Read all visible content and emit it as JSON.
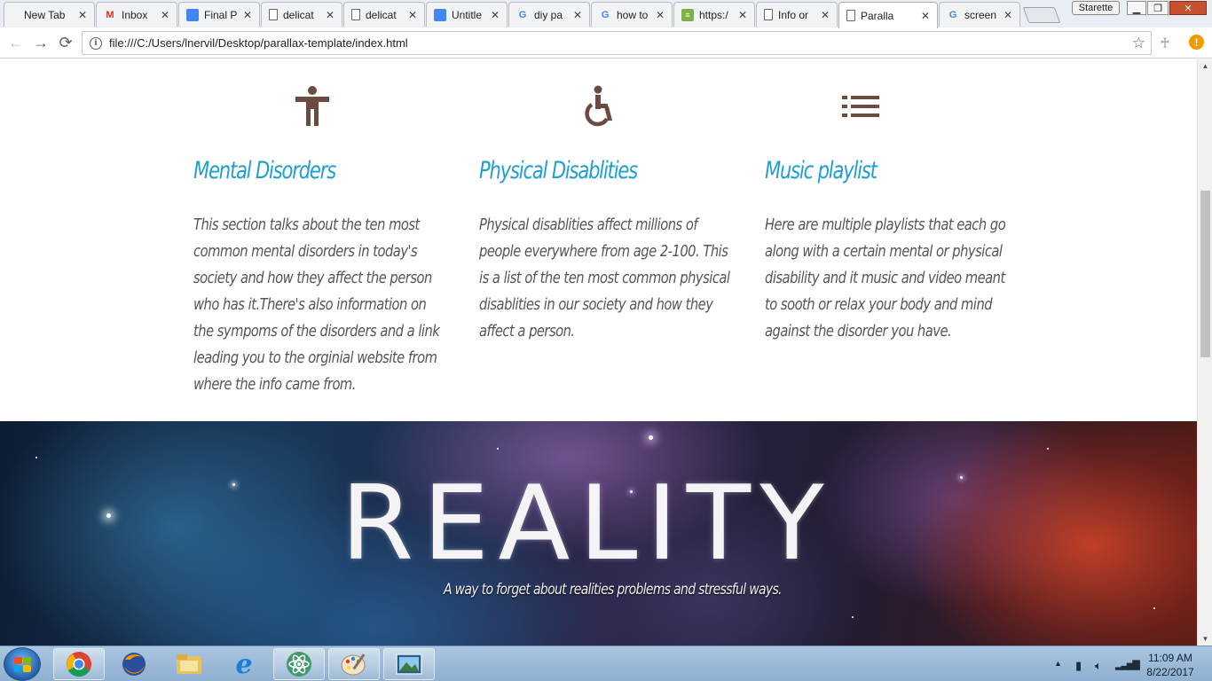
{
  "browser": {
    "tabs": [
      {
        "title": "New Tab",
        "favicon": "none"
      },
      {
        "title": "Inbox",
        "favicon": "gmail-icon"
      },
      {
        "title": "Final P",
        "favicon": "docs-icon"
      },
      {
        "title": "delicat",
        "favicon": "page-icon"
      },
      {
        "title": "delicat",
        "favicon": "page-icon"
      },
      {
        "title": "Untitle",
        "favicon": "docs-icon"
      },
      {
        "title": "diy pa",
        "favicon": "google-icon"
      },
      {
        "title": "how to",
        "favicon": "google-icon"
      },
      {
        "title": "https:/",
        "favicon": "sheets-icon"
      },
      {
        "title": "Info or",
        "favicon": "page-icon"
      },
      {
        "title": "Paralla",
        "favicon": "page-icon",
        "active": true
      },
      {
        "title": "screen",
        "favicon": "google-icon"
      }
    ],
    "profile_name": "Starette",
    "address": "file:///C:/Users/lnervil/Desktop/parallax-template/index.html"
  },
  "page": {
    "columns": [
      {
        "icon": "accessibility-icon",
        "heading": "Mental Disorders",
        "text": "This section talks about the ten most common mental disorders in today's society and how they affect the person who has it.There's also information on the sympoms of the disorders and a link leading you to the orginial website from where the info came from."
      },
      {
        "icon": "wheelchair-icon",
        "heading": "Physical Disablities",
        "text": "Physical disablities affect millions of people everywhere from age 2-100. This is a list of the ten most common physical disablities in our society and how they affect a person."
      },
      {
        "icon": "list-icon",
        "heading": "Music playlist",
        "text": "Here are multiple playlists that each go along with a certain mental or physical disability and it music and video meant to sooth or relax your body and mind against the disorder you have."
      }
    ],
    "hero": {
      "title": "REALITY",
      "tagline": "A way to forget about realities problems and stressful ways."
    }
  },
  "taskbar": {
    "apps": [
      "chrome-icon",
      "firefox-icon",
      "file-explorer-icon",
      "internet-explorer-icon",
      "atom-icon",
      "paint-icon",
      "photo-viewer-icon"
    ],
    "time": "11:09 AM",
    "date": "8/22/2017"
  },
  "colors": {
    "heading": "#1f9fd1",
    "icon": "#6b4a3f",
    "body_text": "#555555"
  }
}
